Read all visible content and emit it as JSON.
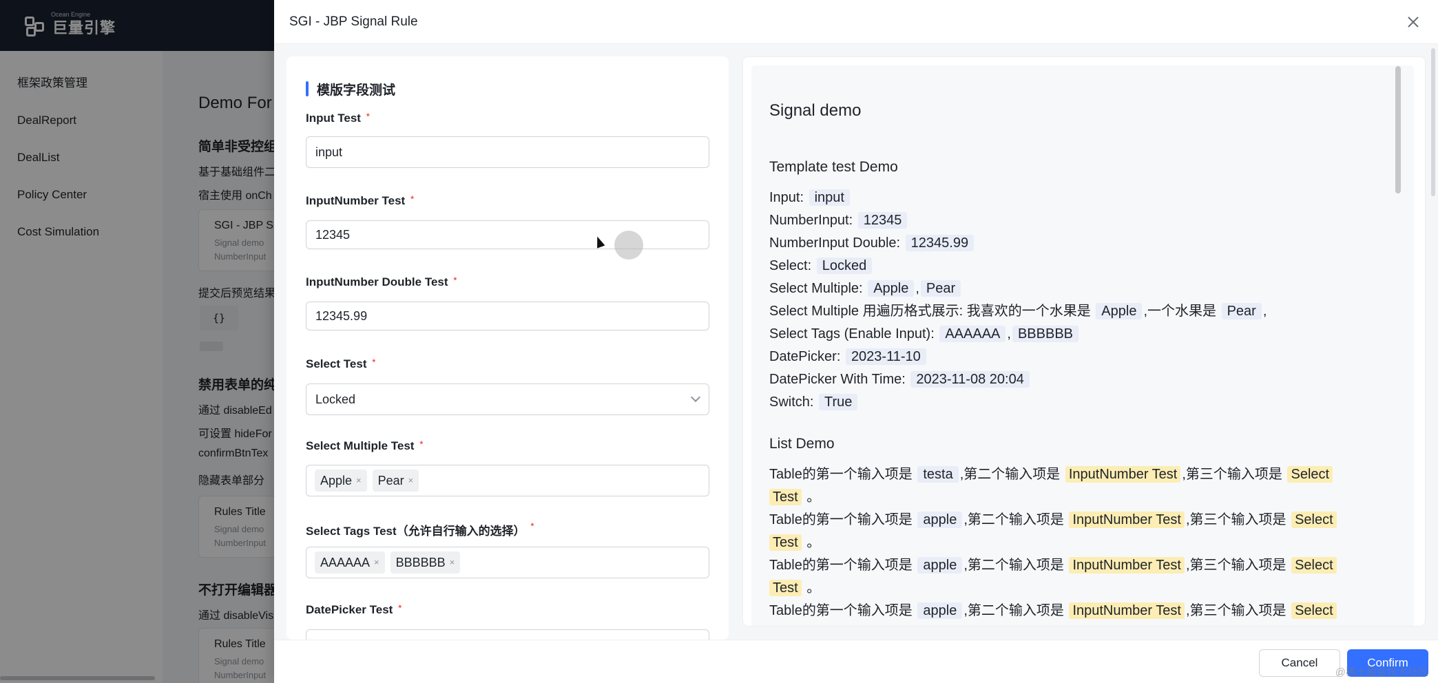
{
  "app": {
    "logo_text": "巨量引擎",
    "logo_sub": "Ocean Engine"
  },
  "sidebar": {
    "items": [
      {
        "label": "框架政策管理"
      },
      {
        "label": "DealReport"
      },
      {
        "label": "DealList"
      },
      {
        "label": "Policy Center"
      },
      {
        "label": "Cost Simulation"
      }
    ],
    "collapse_glyph": "«"
  },
  "background": {
    "title": "Demo For",
    "lines": [
      "简单非受控组",
      "基于基础组件二",
      "宿主使用 onCh",
      "提交后预览结果",
      "禁用表单的纯",
      "通过 disableEd",
      "可设置 hideFor",
      "confirmBtnTex",
      "隐藏表单部分",
      "不打开编辑器",
      "通过 disableVis"
    ],
    "cards": [
      {
        "title": "SGI - JBP S",
        "line1": "Signal demo",
        "line2": "NumberInput"
      },
      {
        "title": "Rules Title",
        "line1": "Signal demo",
        "line2": "NumberInput"
      },
      {
        "title": "Rules Title",
        "line1": "Signal demo",
        "line2": "NumberInput"
      }
    ],
    "code": "{}"
  },
  "drawer": {
    "title": "SGI - JBP Signal Rule",
    "form": {
      "section_title": "模版字段测试",
      "fields": {
        "input": {
          "label": "Input Test",
          "value": "input"
        },
        "input_number": {
          "label": "InputNumber Test",
          "value": "12345"
        },
        "input_number_double": {
          "label": "InputNumber Double Test",
          "value": "12345.99"
        },
        "select": {
          "label": "Select Test",
          "value": "Locked"
        },
        "select_multiple": {
          "label": "Select Multiple Test",
          "tags": [
            "Apple",
            "Pear"
          ]
        },
        "select_tags": {
          "label": "Select Tags Test（允许自行输入的选择）",
          "tags": [
            "AAAAAA",
            "BBBBBB"
          ]
        },
        "date_picker": {
          "label": "DatePicker Test"
        }
      },
      "required_mark": "*",
      "tag_remove": "×"
    },
    "preview": {
      "title": "Signal demo",
      "template_heading": "Template test Demo",
      "rows": [
        {
          "label": "Input:",
          "value": "input"
        },
        {
          "label": "NumberInput:",
          "value": "12345"
        },
        {
          "label": "NumberInput Double:",
          "value": "12345.99"
        },
        {
          "label": "Select:",
          "value": "Locked"
        },
        {
          "label": "Select Multiple:",
          "value": "Apple",
          "sep": ",",
          "value2": "Pear"
        },
        {
          "label": "Select Tags (Enable Input):",
          "value": "AAAAAA",
          "sep": ",",
          "value2": "BBBBBB"
        },
        {
          "label": "DatePicker:",
          "value": "2023-11-10"
        },
        {
          "label": "DatePicker With Time:",
          "value": "2023-11-08 20:04"
        },
        {
          "label": "Switch:",
          "value": "True"
        }
      ],
      "loop_row": {
        "prefix": "Select Multiple 用遍历格式展示: 我喜欢的一个水果是",
        "v1": "Apple",
        "mid": ",一个水果是",
        "v2": "Pear",
        "end": ","
      },
      "list_heading": "List Demo",
      "list_rows": [
        {
          "p1": "Table的第一个输入项是",
          "v1": "testa",
          "p2": ",第二个输入项是",
          "v2": "InputNumber Test",
          "p3": ",第三个输入项是",
          "v3a": "Select",
          "v3b": "Test",
          "end": "。"
        },
        {
          "p1": "Table的第一个输入项是",
          "v1": "apple",
          "p2": ",第二个输入项是",
          "v2": "InputNumber Test",
          "p3": ",第三个输入项是",
          "v3a": "Select",
          "v3b": "Test",
          "end": "。"
        },
        {
          "p1": "Table的第一个输入项是",
          "v1": "apple",
          "p2": ",第二个输入项是",
          "v2": "InputNumber Test",
          "p3": ",第三个输入项是",
          "v3a": "Select",
          "v3b": "Test",
          "end": "。"
        },
        {
          "p1": "Table的第一个输入项是",
          "v1": "apple",
          "p2": ",第二个输入项是",
          "v2": "InputNumber Test",
          "p3": ",第三个输入项是",
          "v3a": "Select"
        }
      ]
    },
    "footer": {
      "cancel": "Cancel",
      "confirm": "Confirm",
      "watermark": "@稀土掘金技术社区"
    }
  },
  "colors": {
    "primary": "#3370ff",
    "required": "#f54a45",
    "highlight_blue": "#e8edf7",
    "highlight_yellow": "#fcedb4",
    "header_bg": "#1b2230"
  }
}
